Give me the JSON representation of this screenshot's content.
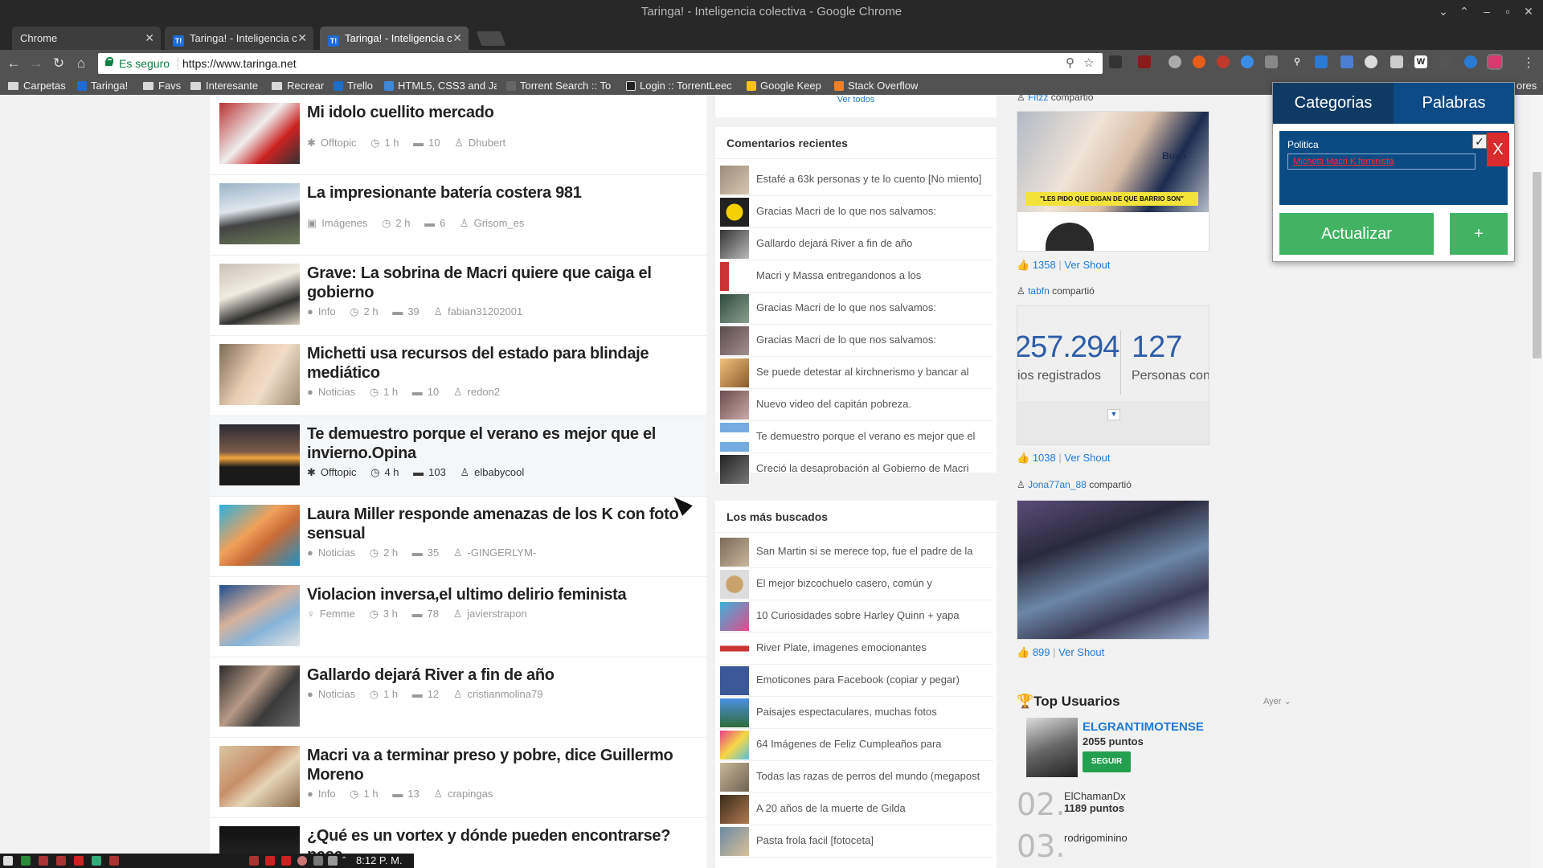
{
  "window": {
    "title": "Taringa! - Inteligencia colectiva - Google Chrome"
  },
  "tabs": [
    {
      "label": "Chrome",
      "icon": "page-icon",
      "active": false
    },
    {
      "label": "Taringa! - Inteligencia c",
      "icon": "taringa-icon",
      "active": false
    },
    {
      "label": "Taringa! - Inteligencia c",
      "icon": "taringa-icon",
      "active": true
    }
  ],
  "omnibox": {
    "security_label": "Es seguro",
    "url": "https://www.taringa.net"
  },
  "bookmarks": [
    {
      "label": "Carpetas",
      "icon": "folder-icon"
    },
    {
      "label": "Taringa!",
      "icon": "taringa-icon"
    },
    {
      "label": "Favs",
      "icon": "folder-icon"
    },
    {
      "label": "Interesante",
      "icon": "folder-icon"
    },
    {
      "label": "Recrear",
      "icon": "folder-icon"
    },
    {
      "label": "Trello",
      "icon": "trello-icon"
    },
    {
      "label": "HTML5, CSS3 and Ja",
      "icon": "chart-icon"
    },
    {
      "label": "Torrent Search :: To",
      "icon": "torrent-icon"
    },
    {
      "label": "Login :: TorrentLeec",
      "icon": "torrentleech-icon"
    },
    {
      "label": "Google Keep",
      "icon": "keep-icon"
    },
    {
      "label": "Stack Overflow",
      "icon": "stackoverflow-icon"
    },
    {
      "label": "ores",
      "icon": "folder-icon"
    }
  ],
  "feed": {
    "posts": [
      {
        "title": "Mi idolo cuellito mercado",
        "category": "Offtopic",
        "age": "1 h",
        "comments": "10",
        "author": "Dhubert"
      },
      {
        "title": "La impresionante batería costera 981",
        "category": "Imágenes",
        "age": "2 h",
        "comments": "6",
        "author": "Grisom_es"
      },
      {
        "title": "Grave: La sobrina de Macri quiere que caiga el gobierno",
        "category": "Info",
        "age": "2 h",
        "comments": "39",
        "author": "fabian31202001"
      },
      {
        "title": "Michetti usa recursos del estado para blindaje mediático",
        "category": "Noticias",
        "age": "1 h",
        "comments": "10",
        "author": "redon2"
      },
      {
        "title": "Te demuestro porque el verano es mejor que el invierno.Opina",
        "category": "Offtopic",
        "age": "4 h",
        "comments": "103",
        "author": "elbabycool"
      },
      {
        "title": "Laura Miller responde amenazas de los K con foto sensual",
        "category": "Noticias",
        "age": "2 h",
        "comments": "35",
        "author": "-GINGERLYM-"
      },
      {
        "title": "Violacion inversa,el ultimo delirio feminista",
        "category": "Femme",
        "age": "3 h",
        "comments": "78",
        "author": "javierstrapon"
      },
      {
        "title": "Gallardo dejará River a fin de año",
        "category": "Noticias",
        "age": "1 h",
        "comments": "12",
        "author": "cristianmolina79"
      },
      {
        "title": "Macri va a terminar preso y pobre, dice Guillermo Moreno",
        "category": "Info",
        "age": "1 h",
        "comments": "13",
        "author": "crapingas"
      },
      {
        "title": "¿Qué es un vortex y dónde pueden encontrarse? pasa",
        "category": "",
        "age": "",
        "comments": "",
        "author": ""
      }
    ]
  },
  "sidebar": {
    "ver_todos": "Ver todos",
    "recent_comments": {
      "title": "Comentarios recientes",
      "items": [
        "Estafé a 63k personas y te lo cuento [No miento]",
        "Gracias Macri de lo que nos salvamos:",
        "Gallardo dejará River a fin de año",
        "Macri y Massa entregandonos a los",
        "Gracias Macri de lo que nos salvamos:",
        "Gracias Macri de lo que nos salvamos:",
        "Se puede detestar al kirchnerismo y bancar al",
        "Nuevo video del capitán pobreza.",
        "Te demuestro porque el verano es mejor que el",
        "Creció la desaprobación al Gobierno de Macri"
      ]
    },
    "most_searched": {
      "title": "Los más buscados",
      "items": [
        "San Martin si se merece top, fue el padre de la",
        "El mejor bizcochuelo casero, común y",
        "10 Curiosidades sobre Harley Quinn + yapa",
        "River Plate, imagenes emocionantes",
        "Emoticones para Facebook (copiar y pegar)",
        "Paisajes espectaculares, muchas fotos",
        "64 Imágenes de Feliz Cumpleaños para",
        "Todas las razas de perros del mundo (megapost",
        "A 20 años de la muerte de Gilda",
        "Pasta frola facil [fotoceta]"
      ]
    }
  },
  "shouts": [
    {
      "user": "Fitzz",
      "action": "compartió",
      "likes": "1358",
      "link": "Ver Shout",
      "caption": "\"LES PIDO QUE DIGAN DE QUE BARRIO SON\"",
      "overlay": "Buen"
    },
    {
      "user": "tabfn",
      "action": "compartió",
      "likes": "1038",
      "link": "Ver Shout",
      "stat1": "257.294",
      "stat1_label": "ios registrados",
      "stat2": "127",
      "stat2_label": "Personas conecta"
    },
    {
      "user": "Jona77an_88",
      "action": "compartió",
      "likes": "899",
      "link": "Ver Shout"
    }
  ],
  "top_users": {
    "title": "Top Usuarios",
    "period": "Ayer",
    "first": {
      "name": "ELGRANTIMOTENSE",
      "points": "2055 puntos",
      "follow": "SEGUIR"
    },
    "second": {
      "rank": "02.",
      "name": "ElChamanDx",
      "points": "1189 puntos"
    },
    "third": {
      "rank": "03.",
      "name": "rodrigominino"
    }
  },
  "popup": {
    "tab_categories": "Categorias",
    "tab_words": "Palabras",
    "category": "Politica",
    "checked": "✓",
    "words_value": "Michetti Macri K feminista",
    "close": "X",
    "update": "Actualizar",
    "add": "+"
  },
  "taskbar": {
    "clock": "8:12 P. M."
  },
  "colors": {
    "link": "#1f7bd6",
    "popup_blue": "#0b4b84",
    "popup_green": "#42b362",
    "close_red": "#d92b2b"
  }
}
